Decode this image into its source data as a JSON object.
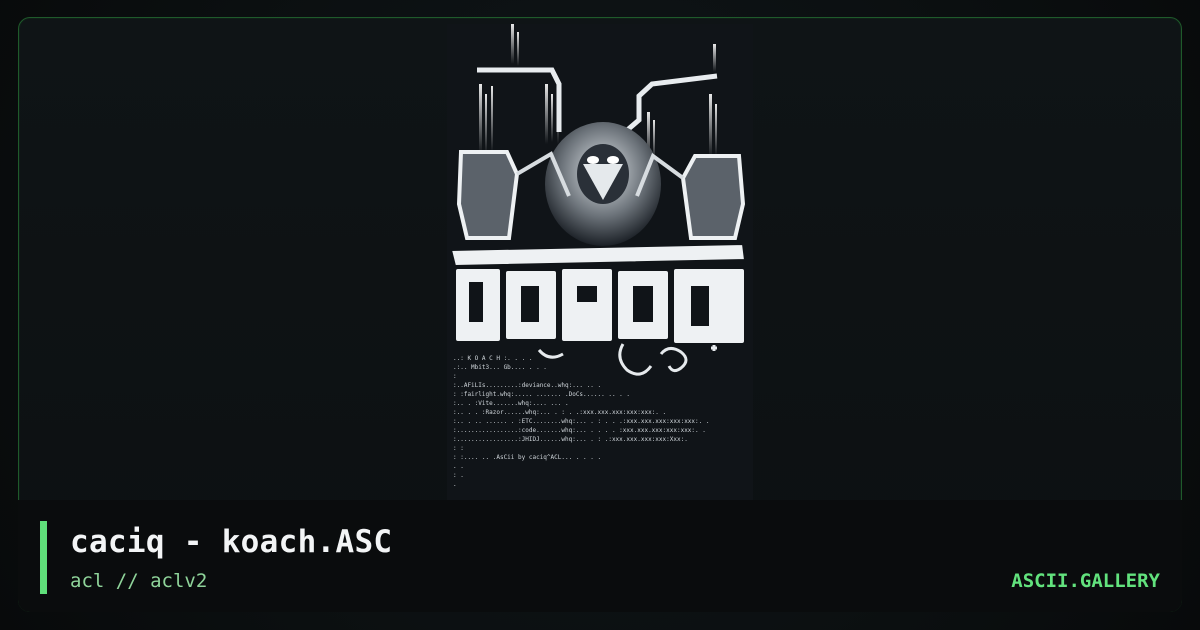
{
  "artwork": {
    "logo_text": "KOACH",
    "nfo_lines": [
      "..: K O A C H :. . . .",
      ".:..  Mbit3...  Gb.... . .  .",
      ":",
      ":..AFiLIs.........:deviance..whq:...  .. .",
      ":                 :fairlight.whq:..... ....... .DoCs...... .. .   .",
      ":.. .             :Vite.......whq:.... ... .",
      ":..           . . :Razor......whq:... .   :    . .:xxx.xxx.xxx:xxx:xxx:. .",
      ":.. . .. ...... . :ETC........whq:... .   :  . . .:xxx.xxx.xxx:xxx:xxx:. .",
      ":.................:code.......whq:... .   .   . . :xxx.xxx.xxx:xxx:xxx:. .",
      ":.................:JHIDJ......whq:... .   :      .:xxx.xxx.xxx:xxx:Xxx:.",
      ":                 :",
      ":                 :.... ..  .AsCii by caciq^ACL... .  .   .     .",
      ".                   .",
      ":                   .",
      ".  "
    ]
  },
  "caption": {
    "title": "caciq - koach.ASC",
    "subtitle": "acl // aclv2",
    "brand": "ASCII.GALLERY"
  },
  "colors": {
    "accent": "#5fe07a",
    "brand": "#62e27d",
    "border": "#1f5a2b",
    "background": "#0b0f10"
  }
}
